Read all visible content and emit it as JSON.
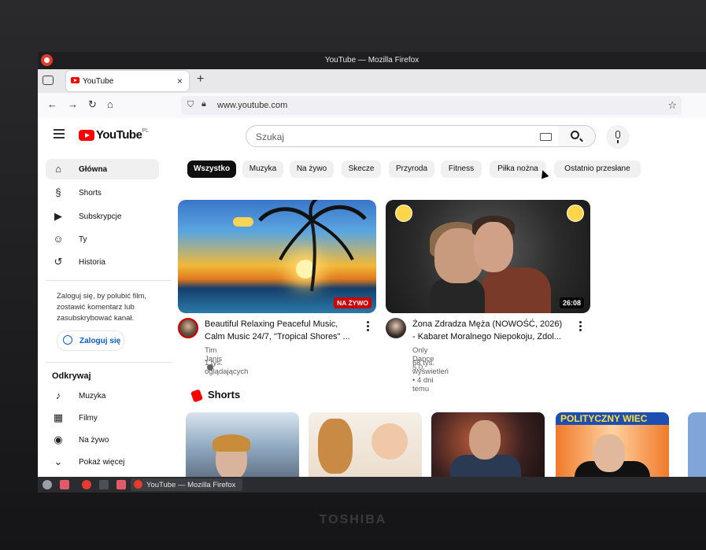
{
  "window": {
    "title": "YouTube — Mozilla Firefox"
  },
  "tab": {
    "label": "YouTube",
    "close": "×",
    "new_tab": "+"
  },
  "navbar": {
    "url": "www.youtube.com"
  },
  "youtube": {
    "logo_text": "YouTube",
    "region": "PL",
    "search_placeholder": "Szukaj"
  },
  "sidebar": {
    "items": [
      {
        "label": "Główna",
        "icon": "home-icon"
      },
      {
        "label": "Shorts",
        "icon": "shorts-icon"
      },
      {
        "label": "Subskrypcje",
        "icon": "subscriptions-icon"
      },
      {
        "label": "Ty",
        "icon": "you-icon"
      },
      {
        "label": "Historia",
        "icon": "history-icon"
      }
    ],
    "signin_note": "Zaloguj się, by polubić film, zostawić komentarz lub zasubskrybować kanał.",
    "signin_label": "Zaloguj się",
    "explore_title": "Odkrywaj",
    "explore": [
      {
        "label": "Muzyka",
        "icon": "music-icon"
      },
      {
        "label": "Filmy",
        "icon": "film-icon"
      },
      {
        "label": "Na żywo",
        "icon": "live-icon"
      },
      {
        "label": "Pokaż więcej",
        "icon": "chevron-down-icon"
      }
    ]
  },
  "chips": [
    "Wszystko",
    "Muzyka",
    "Na żywo",
    "Skecze",
    "Przyroda",
    "Fitness",
    "Piłka nożna",
    "Ostatnio przesłane"
  ],
  "videos": [
    {
      "title_line1": "Beautiful Relaxing Peaceful Music,",
      "title_line2": "Calm Music 24/7, \"Tropical Shores\" ...",
      "channel": "Tim Janis",
      "meta": "1 tys. oglądających",
      "badge": "NA ŻYWO"
    },
    {
      "title_line1": "Żona Zdradza Męża (NOWOŚĆ, 2026)",
      "title_line2": "- Kabaret Moralnego Niepokoju, Zdol...",
      "channel": "Only Dance 5.0",
      "meta": "68 tys. wyświetleń • 4 dni temu",
      "badge": "26:08"
    }
  ],
  "shorts": {
    "title": "Shorts",
    "banner": "POLITYCZNY WIEC"
  },
  "taskbar": {
    "window_label": "YouTube — Mozilla Firefox"
  },
  "bezel": {
    "brand": "TOSHIBA"
  }
}
